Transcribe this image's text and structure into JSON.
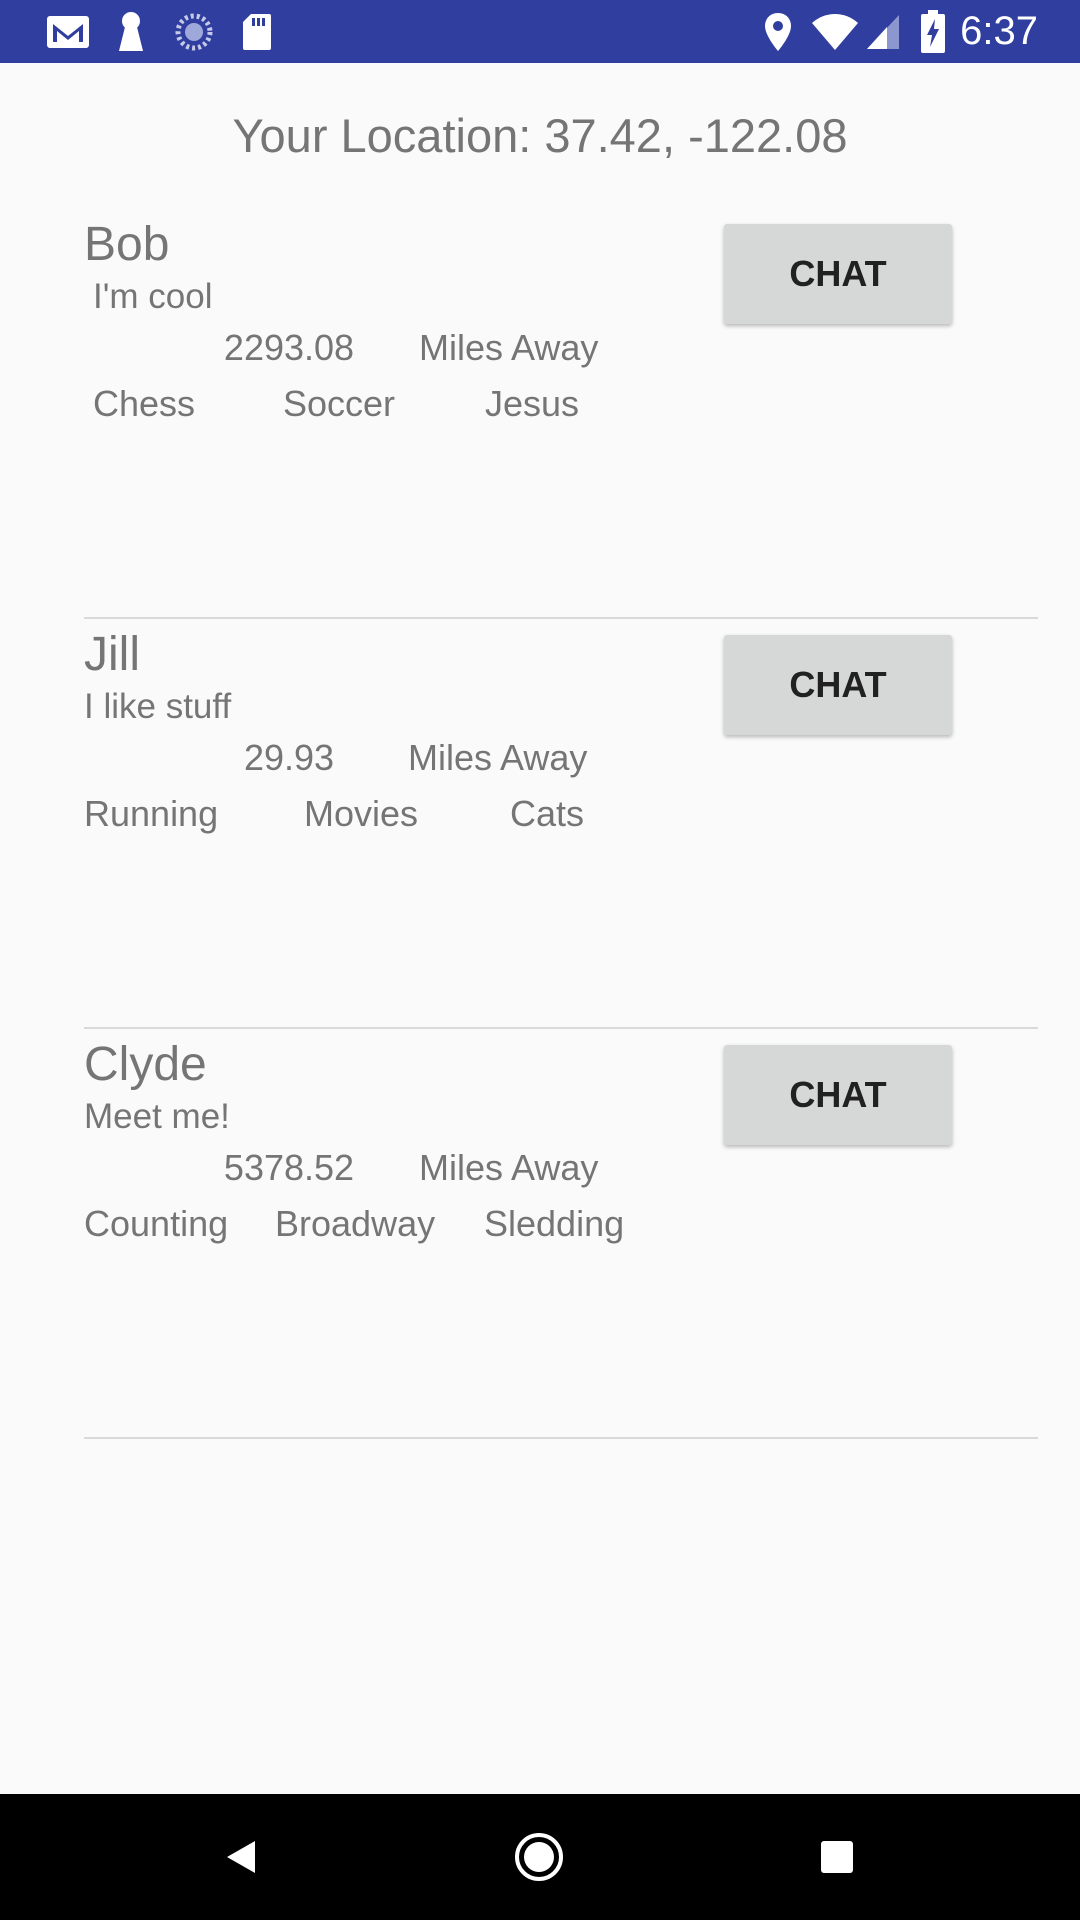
{
  "status_bar": {
    "time": "6:37",
    "left_icons": [
      "gmail-icon",
      "keyhole-icon",
      "sync-icon",
      "sd-card-icon"
    ],
    "right_icons": [
      "location-pin-icon",
      "wifi-icon",
      "signal-icon",
      "battery-charging-icon"
    ],
    "background": "#303f9f"
  },
  "location": {
    "label": "Your Location:  37.42, -122.08"
  },
  "users": [
    {
      "name": "Bob",
      "status": "I'm cool",
      "distance": "2293.08",
      "distance_unit": "Miles Away",
      "interests": [
        "Chess",
        "Soccer",
        "Jesus"
      ],
      "chat_label": "CHAT"
    },
    {
      "name": "Jill",
      "status": "I like stuff",
      "distance": "29.93",
      "distance_unit": "Miles Away",
      "interests": [
        "Running",
        "Movies",
        "Cats"
      ],
      "chat_label": "CHAT"
    },
    {
      "name": "Clyde",
      "status": "Meet me!",
      "distance": "5378.52",
      "distance_unit": "Miles Away",
      "interests": [
        "Counting",
        "Broadway",
        "Sledding"
      ],
      "chat_label": "CHAT"
    }
  ],
  "nav_bar": {
    "icons": [
      "back-icon",
      "home-icon",
      "recents-icon"
    ]
  }
}
